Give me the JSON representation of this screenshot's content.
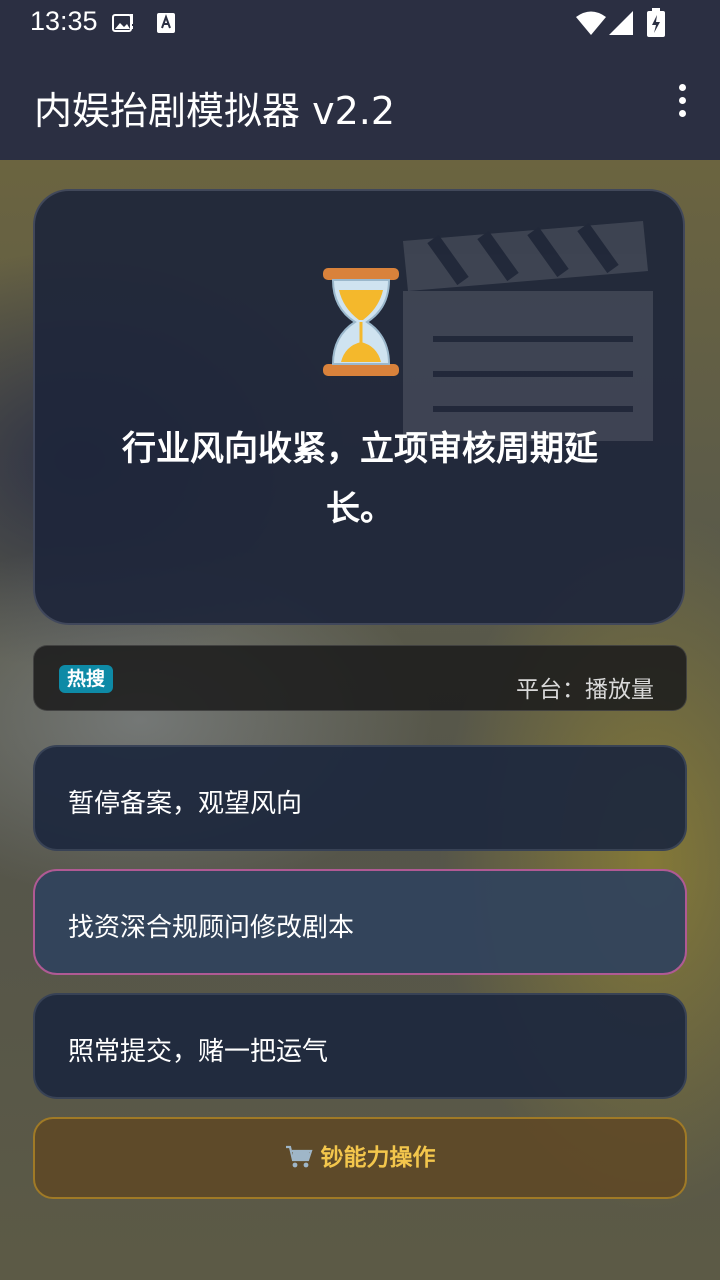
{
  "status_bar": {
    "time": "13:35"
  },
  "app_bar": {
    "title": "内娱抬剧模拟器 v2.2"
  },
  "event": {
    "icon": "hourglass-icon",
    "text": "行业风向收紧，立项审核周期延长。"
  },
  "ticker": {
    "badge": "热搜",
    "text": "平台：播放量"
  },
  "options": [
    {
      "label": "暂停备案，观望风向",
      "selected": false
    },
    {
      "label": "找资深合规顾问修改剧本",
      "selected": true
    },
    {
      "label": "照常提交，赌一把运气",
      "selected": false
    }
  ],
  "shop": {
    "label": "钞能力操作",
    "icon": "cart-icon"
  },
  "colors": {
    "app_bar": "#2b2f42",
    "hot_badge": "#0e8aa6",
    "shop_text": "#f3c64c",
    "selected_border": "#b05a94"
  }
}
